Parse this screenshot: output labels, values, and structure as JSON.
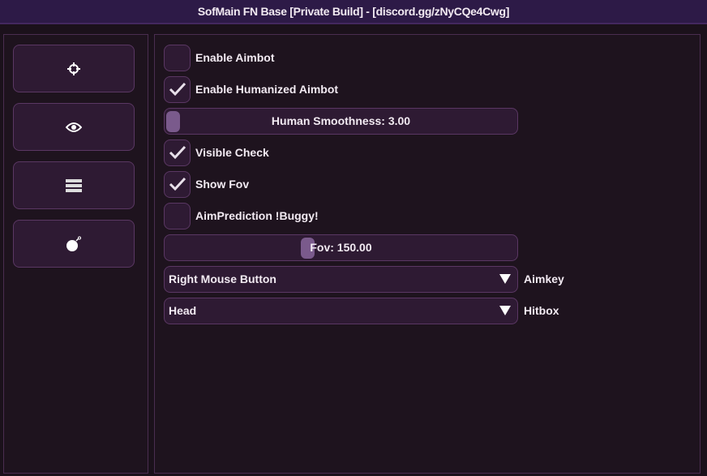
{
  "window": {
    "title": "SofMain FN Base [Private Build] - [discord.gg/zNyCQe4Cwg]"
  },
  "sidebar": {
    "items": [
      {
        "icon": "crosshair-icon"
      },
      {
        "icon": "eye-icon"
      },
      {
        "icon": "server-icon"
      },
      {
        "icon": "bomb-icon"
      }
    ]
  },
  "aimbot": {
    "enable_aimbot": {
      "label": "Enable Aimbot",
      "checked": false
    },
    "enable_humanized": {
      "label": "Enable Humanized Aimbot",
      "checked": true
    },
    "smoothness": {
      "label": "Human Smoothness: 3.00",
      "value": 3.0,
      "fraction": 0.0
    },
    "visible_check": {
      "label": "Visible Check",
      "checked": true
    },
    "show_fov": {
      "label": "Show Fov",
      "checked": true
    },
    "aim_prediction": {
      "label": "AimPrediction !Buggy!",
      "checked": false
    },
    "fov": {
      "label": "Fov: 150.00",
      "value": 150.0
    },
    "aimkey": {
      "value": "Right Mouse Button",
      "label": "Aimkey"
    },
    "hitbox": {
      "value": "Head",
      "label": "Hitbox"
    }
  }
}
